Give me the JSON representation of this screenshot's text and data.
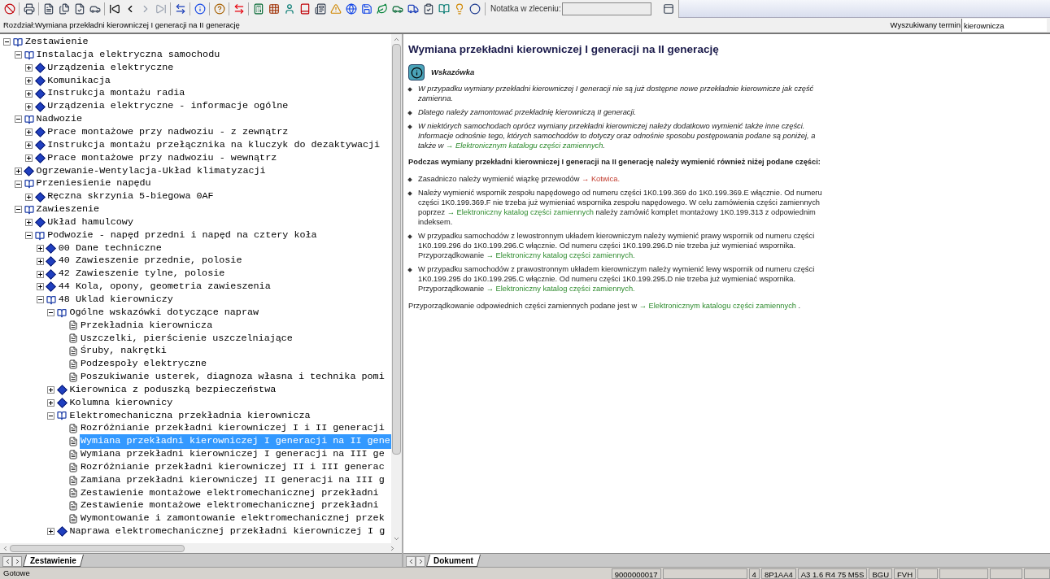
{
  "toolbar": {
    "note_label": "Notatka w zleceniu:",
    "note_field": {
      "disabled": true
    }
  },
  "chapter_bar": {
    "chapter": "Rozdział:Wymiana przekładni kierowniczej I generacji na II generację",
    "search_label": "Wyszukiwany termin",
    "search_value": "kierownicza"
  },
  "tree": [
    {
      "label": "Zestawienie",
      "kind": "book",
      "expanded": true,
      "selected": false,
      "children": [
        {
          "label": "Instalacja elektryczna samochodu",
          "kind": "book",
          "expanded": true,
          "selected": false,
          "children": [
            {
              "label": "Urządzenia elektryczne",
              "kind": "book",
              "expanded": false,
              "selected": false
            },
            {
              "label": "Komunikacja",
              "kind": "book",
              "expanded": false,
              "selected": false
            },
            {
              "label": "Instrukcja montażu radia",
              "kind": "book",
              "expanded": false,
              "selected": false
            },
            {
              "label": "Urządzenia elektryczne - informacje ogólne",
              "kind": "book",
              "expanded": false,
              "selected": false
            }
          ]
        },
        {
          "label": "Nadwozie",
          "kind": "book",
          "expanded": true,
          "selected": false,
          "children": [
            {
              "label": "Prace montażowe przy nadwoziu - z zewnątrz",
              "kind": "book",
              "expanded": false,
              "selected": false
            },
            {
              "label": "Instrukcja montażu przełącznika na kluczyk do dezaktywacji",
              "kind": "book",
              "expanded": false,
              "selected": false
            },
            {
              "label": "Prace montażowe przy nadwoziu - wewnątrz",
              "kind": "book",
              "expanded": false,
              "selected": false
            }
          ]
        },
        {
          "label": "Ogrzewanie-Wentylacja-Układ klimatyzacji",
          "kind": "book",
          "expanded": false,
          "selected": false
        },
        {
          "label": "Przeniesienie napędu",
          "kind": "book",
          "expanded": true,
          "selected": false,
          "children": [
            {
              "label": "Ręczna skrzynia 5-biegowa 0AF",
              "kind": "book",
              "expanded": false,
              "selected": false
            }
          ]
        },
        {
          "label": "Zawieszenie",
          "kind": "book",
          "expanded": true,
          "selected": false,
          "children": [
            {
              "label": "Układ hamulcowy",
              "kind": "book",
              "expanded": false,
              "selected": false
            },
            {
              "label": "Podwozie - napęd przedni i napęd na cztery koła",
              "kind": "book",
              "expanded": true,
              "selected": false,
              "children": [
                {
                  "label": "00 Dane techniczne",
                  "kind": "book",
                  "expanded": false,
                  "selected": false
                },
                {
                  "label": "40 Zawieszenie przednie, polosie",
                  "kind": "book",
                  "expanded": false,
                  "selected": false
                },
                {
                  "label": "42 Zawieszenie tylne, polosie",
                  "kind": "book",
                  "expanded": false,
                  "selected": false
                },
                {
                  "label": "44 Kola, opony, geometria zawieszenia",
                  "kind": "book",
                  "expanded": false,
                  "selected": false
                },
                {
                  "label": "48 Uklad kierowniczy",
                  "kind": "book",
                  "expanded": true,
                  "selected": false,
                  "children": [
                    {
                      "label": "Ogólne wskazówki dotyczące napraw",
                      "kind": "book",
                      "expanded": true,
                      "selected": false,
                      "children": [
                        {
                          "label": "Przekładnia kierownicza",
                          "kind": "page",
                          "selected": false
                        },
                        {
                          "label": "Uszczelki, pierścienie uszczelniające",
                          "kind": "page",
                          "selected": false
                        },
                        {
                          "label": "Śruby, nakrętki",
                          "kind": "page",
                          "selected": false
                        },
                        {
                          "label": "Podzespoły elektryczne",
                          "kind": "page",
                          "selected": false
                        },
                        {
                          "label": "Poszukiwanie usterek, diagnoza własna i technika pomi",
                          "kind": "page",
                          "selected": false
                        }
                      ]
                    },
                    {
                      "label": "Kierownica z poduszką bezpieczeństwa",
                      "kind": "book",
                      "expanded": false,
                      "selected": false
                    },
                    {
                      "label": "Kolumna kierownicy",
                      "kind": "book",
                      "expanded": false,
                      "selected": false
                    },
                    {
                      "label": "Elektromechaniczna przekładnia kierownicza",
                      "kind": "book",
                      "expanded": true,
                      "selected": false,
                      "children": [
                        {
                          "label": "Rozróżnianie przekładni kierowniczej I i II generacji",
                          "kind": "page",
                          "selected": false
                        },
                        {
                          "label": "Wymiana przekładni kierowniczej I generacji na II gene",
                          "kind": "page",
                          "selected": true
                        },
                        {
                          "label": "Wymiana przekładni kierowniczej I generacji na III ge",
                          "kind": "page",
                          "selected": false
                        },
                        {
                          "label": "Rozróżnianie przekładni kierowniczej II i III generac",
                          "kind": "page",
                          "selected": false
                        },
                        {
                          "label": "Zamiana przekładni kierowniczej II generacji na III g",
                          "kind": "page",
                          "selected": false
                        },
                        {
                          "label": "Zestawienie montażowe elektromechanicznej przekładni",
                          "kind": "page",
                          "selected": false
                        },
                        {
                          "label": "Zestawienie montażowe elektromechanicznej przekładni",
                          "kind": "page",
                          "selected": false
                        },
                        {
                          "label": "Wymontowanie i zamontowanie elektromechanicznej przek",
                          "kind": "page",
                          "selected": false
                        }
                      ]
                    },
                    {
                      "label": "Naprawa elektromechanicznej przekładni kierowniczej I g",
                      "kind": "book",
                      "expanded": false,
                      "selected": false
                    }
                  ]
                }
              ]
            }
          ]
        }
      ]
    }
  ],
  "document": {
    "title": "Wymiana przekładni kierowniczej I generacji na II generację",
    "note": {
      "heading": "Wskazówka",
      "items": [
        [
          {
            "kind": "text",
            "text": "W przypadku wymiany przekładni kierowniczej I generacji nie są już dostępne nowe przekładnie kierownicze jak część zamienna."
          }
        ],
        [
          {
            "kind": "text",
            "text": "Dlatego należy zamontować przekładnię kierowniczą II generacji."
          }
        ],
        [
          {
            "kind": "text",
            "text": "W niektórych samochodach oprócz wymiany przekładni kierowniczej należy dodatkowo wymienić także inne części. Informacje odnośnie tego, których samochodów to dotyczy oraz odnośnie sposobu postępowania podane są poniżej, a także w "
          },
          {
            "kind": "link",
            "text": "→ Elektronicznym katalogu części zamiennych"
          },
          {
            "kind": "text",
            "text": "."
          }
        ]
      ]
    },
    "intro": "Podczas wymiany przekładni kierowniczej I generacji na II generację należy wymienić również niżej podane części:",
    "items": [
      [
        {
          "kind": "text",
          "text": "Zasadniczo należy wymienić wiązkę przewodów "
        },
        {
          "kind": "alert_link",
          "text": "→ Kotwica."
        }
      ],
      [
        {
          "kind": "text",
          "text": "Należy wymienić wspornik zespołu napędowego od numeru części 1K0.199.369 do 1K0.199.369.E włącznie. Od numeru części 1K0.199.369.F nie trzeba już wymieniać wspornika zespołu napędowego. W celu zamówienia części zamiennych poprzez "
        },
        {
          "kind": "link",
          "text": "→ Elektroniczny katalog części zamiennych"
        },
        {
          "kind": "text",
          "text": " należy zamówić komplet montażowy 1K0.199.313 z odpowiednim indeksem."
        }
      ],
      [
        {
          "kind": "text",
          "text": "W przypadku samochodów z lewostronnym układem kierowniczym należy wymienić prawy wspornik od numeru części 1K0.199.296 do 1K0.199.296.C włącznie. Od numeru części 1K0.199.296.D nie trzeba już wymieniać wspornika. Przyporządkowanie "
        },
        {
          "kind": "link",
          "text": "→ Elektroniczny katalog części zamiennych."
        }
      ],
      [
        {
          "kind": "text",
          "text": "W przypadku samochodów z prawostronnym układem kierowniczym należy wymienić lewy wspornik od numeru części 1K0.199.295 do 1K0.199.295.C włącznie. Od numeru części 1K0.199.295.D nie trzeba już wymieniać wspornika. Przyporządkowanie "
        },
        {
          "kind": "link",
          "text": "→ Elektroniczny katalog części zamiennych."
        }
      ]
    ],
    "footer": [
      {
        "kind": "text",
        "text": "Przyporządkowanie odpowiednich części zamiennych podane jest w "
      },
      {
        "kind": "link",
        "text": "→ Elektronicznym katalogu części zamiennych"
      },
      {
        "kind": "text",
        "text": " ."
      }
    ]
  },
  "left_tabs": [
    {
      "label": "Zestawienie",
      "selected": true
    }
  ],
  "right_tabs": [
    {
      "label": "Dokument",
      "selected": true
    }
  ],
  "status_bar": {
    "message": "Gotowe",
    "cells": [
      "9000000017",
      "",
      "4",
      "8P1AA4",
      "A3 1.6 R4 75 M5S",
      "BGU",
      "FVH"
    ]
  }
}
